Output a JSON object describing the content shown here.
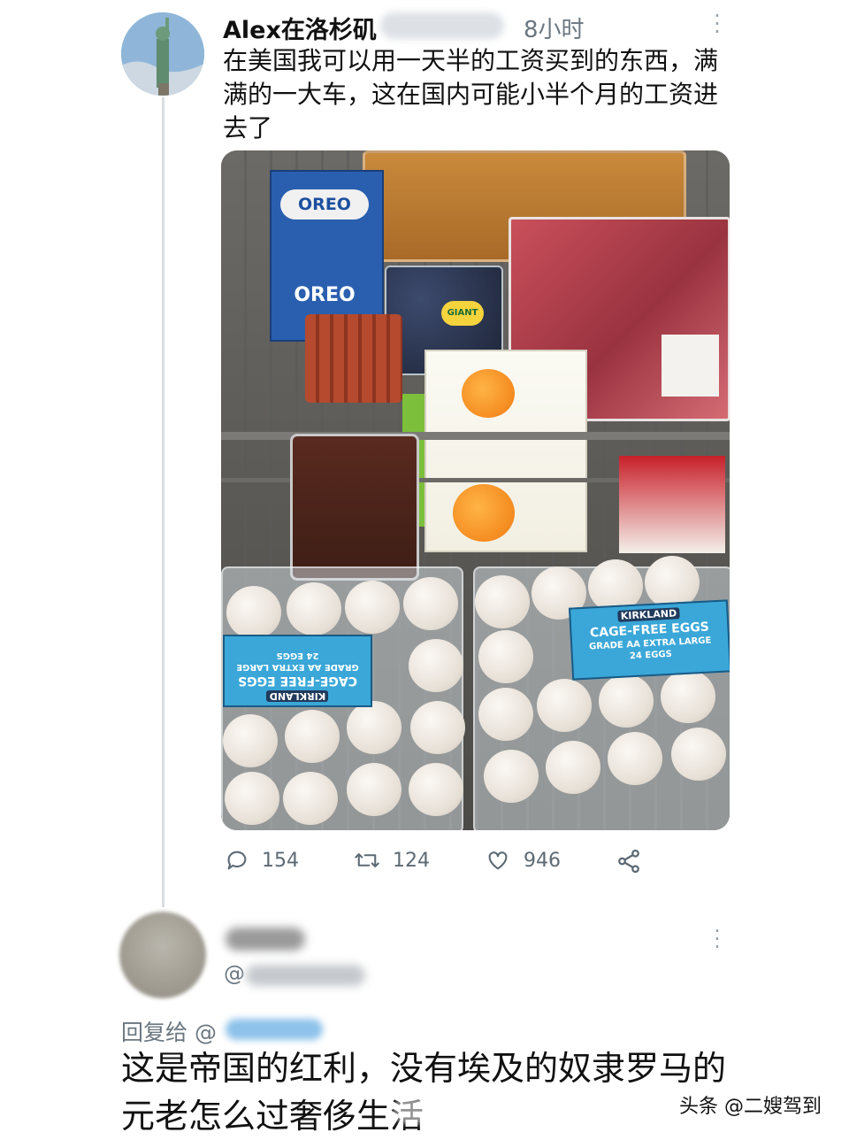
{
  "tweet": {
    "author_name": "Alex在洛杉矶",
    "time": "8小时",
    "text": "在美国我可以用一天半的工资买到的东西，满满的一大车，这在国内可能小半个月的工资进去了",
    "photo": {
      "oreo_label": "OREO",
      "giant_label": "GIANT",
      "egg_brand": "KIRKLAND",
      "egg_label_line1": "CAGE-FREE EGGS",
      "egg_label_line2": "GRADE AA EXTRA LARGE",
      "egg_label_line3": "24 EGGS"
    },
    "actions": {
      "replies": "154",
      "retweets": "124",
      "likes": "946"
    },
    "icons": [
      "reply-icon",
      "retweet-icon",
      "like-icon",
      "share-icon",
      "more-icon"
    ]
  },
  "reply": {
    "handle_prefix": "@",
    "replying_to_label": "回复给 @",
    "text": "这是帝国的红利，没有埃及的奴隶罗马的元老怎么过奢侈生活"
  },
  "watermark": "头条 @二嫂驾到",
  "colors": {
    "secondary_text": "#6b7780",
    "thread_line": "#d8dde2",
    "egg_label": "#3aa7d8"
  }
}
